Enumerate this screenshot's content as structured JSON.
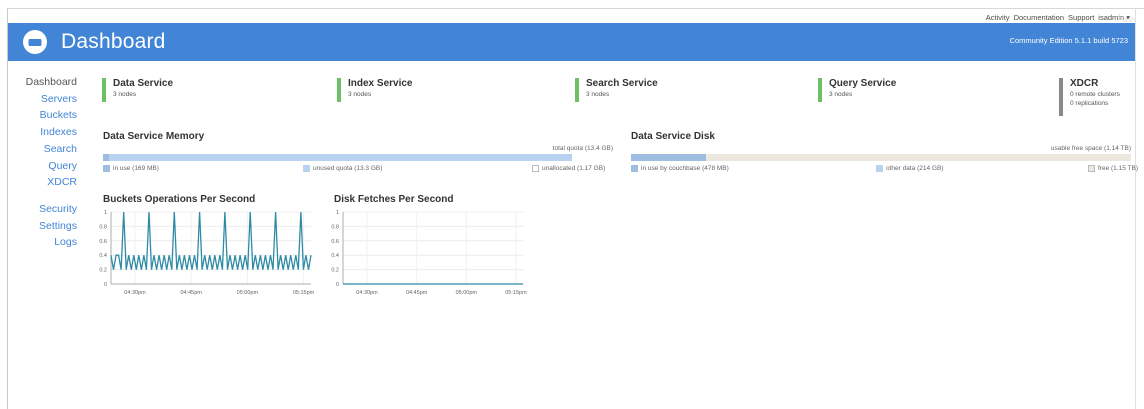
{
  "top_links": [
    "Activity",
    "Documentation",
    "Support",
    "isadmin ▾"
  ],
  "header": {
    "title": "Dashboard",
    "edition": "Community Edition 5.1.1 build 5723",
    "pin": "Flash"
  },
  "sidebar": {
    "items": [
      {
        "label": "Dashboard",
        "active": true
      },
      {
        "label": "Servers"
      },
      {
        "label": "Buckets"
      },
      {
        "label": "Indexes"
      },
      {
        "label": "Search"
      },
      {
        "label": "Query"
      },
      {
        "label": "XDCR"
      },
      {
        "label": "Security"
      },
      {
        "label": "Settings"
      },
      {
        "label": "Logs"
      }
    ]
  },
  "services": [
    {
      "name": "Data Service",
      "sub": "3 nodes"
    },
    {
      "name": "Index Service",
      "sub": "3 nodes"
    },
    {
      "name": "Search Service",
      "sub": "3 nodes"
    },
    {
      "name": "Query Service",
      "sub": "3 nodes"
    },
    {
      "name": "XDCR",
      "sub": "0 remote clusters",
      "sub2": "0 replications"
    }
  ],
  "memory": {
    "title": "Data Service Memory",
    "quota": "total quota (13.4 GB)",
    "in_use": "in use (169 MB)",
    "unused": "unused quota (13.3 GB)",
    "unallocated": "unallocated (1.17 GB)",
    "in_use_fraction": 0.012,
    "quota_fraction": 0.92
  },
  "disk": {
    "title": "Data Service Disk",
    "free_space": "usable free space (1.14 TB)",
    "in_use": "in use by couchbase (478 MB)",
    "other": "other data (214 GB)",
    "free": "free (1.15 TB)",
    "used_fraction": 0.15
  },
  "colors": {
    "header": "#4285d6",
    "service_ok": "#6dc066",
    "service_xdcr": "#888888",
    "bar_in_use": "#9fbde0",
    "bar_unused": "#b9d2ef",
    "bar_free": "#ede8df",
    "line": "#2f8aa6"
  },
  "chart_data": [
    {
      "type": "line",
      "title": "Buckets Operations Per Second",
      "xlabel": "",
      "ylabel": "",
      "ylim": [
        0,
        1
      ],
      "yticks": [
        0,
        0.2,
        0.4,
        0.6,
        0.8,
        1
      ],
      "xticks": [
        "04:30pm",
        "04:45pm",
        "05:00pm",
        "05:15pm"
      ],
      "series": [
        {
          "values": [
            0.4,
            0.2,
            0.4,
            0.4,
            0.2,
            1,
            0.2,
            0.4,
            0.2,
            0.4,
            0.2,
            0.4,
            0.2,
            0.4,
            0.2,
            1,
            0.2,
            0.4,
            0.2,
            0.4,
            0.2,
            0.4,
            0.2,
            0.4,
            0.2,
            1,
            0.2,
            0.4,
            0.2,
            0.4,
            0.2,
            0.4,
            0.2,
            0.4,
            0.2,
            1,
            0.2,
            0.4,
            0.2,
            0.4,
            0.2,
            0.4,
            0.2,
            0.4,
            0.2,
            1,
            0.2,
            0.4,
            0.2,
            0.4,
            0.2,
            0.4,
            0.2,
            0.4,
            0.2,
            1,
            0.2,
            0.4,
            0.2,
            0.4,
            0.2,
            0.4,
            0.2,
            0.4,
            0.2,
            1,
            0.2,
            0.4,
            0.2,
            0.4,
            0.2,
            0.4,
            0.2,
            0.4,
            0.2,
            1,
            0.2,
            0.4,
            0.2,
            0.4
          ]
        }
      ]
    },
    {
      "type": "line",
      "title": "Disk Fetches Per Second",
      "xlabel": "",
      "ylabel": "",
      "ylim": [
        0,
        1
      ],
      "yticks": [
        0,
        0.2,
        0.4,
        0.6,
        0.8,
        1
      ],
      "xticks": [
        "04:30pm",
        "04:45pm",
        "05:00pm",
        "05:15pm"
      ],
      "series": [
        {
          "values": [
            0,
            0,
            0,
            0,
            0,
            0,
            0,
            0,
            0,
            0,
            0,
            0,
            0,
            0,
            0,
            0,
            0,
            0,
            0,
            0
          ]
        }
      ]
    }
  ]
}
